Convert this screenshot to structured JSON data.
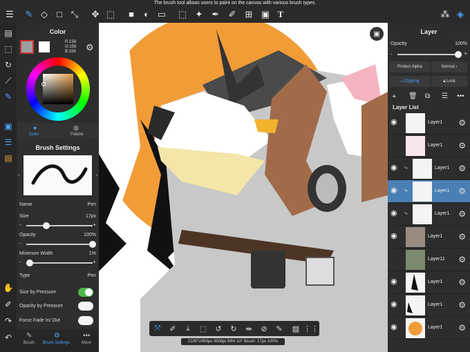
{
  "tooltip": "The brush tool allows users to paint on the canvas with various brush types.",
  "color_panel": {
    "title": "Color",
    "rgb": {
      "r": "R:158",
      "g": "G:158",
      "b": "B:158"
    },
    "tabs": [
      "Color",
      "Palette"
    ]
  },
  "brush_panel": {
    "title": "Brush Settings",
    "name_label": "Name",
    "name_value": "Pen",
    "size_label": "Size",
    "size_value": "17px",
    "size_fraction": 0.3,
    "opacity_label": "Opacity",
    "opacity_value": "100%",
    "opacity_fraction": 1.0,
    "min_width_label": "Minimum Width",
    "min_width_value": "1%",
    "min_width_fraction": 0.05,
    "type_label": "Type",
    "type_value": "Pen",
    "size_by_pressure": "Size by Pressure",
    "opacity_by_pressure": "Opacity by Pressure",
    "force_fade": "Force Fade In/ Out"
  },
  "bottom_tabs": [
    "Brush",
    "Brush Settings",
    "More"
  ],
  "layer_panel": {
    "title": "Layer",
    "opacity_label": "Opacity",
    "opacity_value": "100%",
    "protect_alpha": "Protect Alpha",
    "blend_mode": "Normal",
    "clipping": "Clipping",
    "lock": "Lock",
    "list_title": "Layer List",
    "layers": [
      "Layer1",
      "Layer1",
      "Layer1",
      "Layer1",
      "Layer1",
      "Layer1",
      "Layer11",
      "Layer1",
      "Layer1",
      "Layer1"
    ]
  },
  "status": "2100*2450px 350dpi 93% 10° Brush: 17px 100%",
  "colors": {
    "accent": "#4a7fb5",
    "canvas_sun": "#f29c38",
    "toggle_on": "#4cb848"
  }
}
